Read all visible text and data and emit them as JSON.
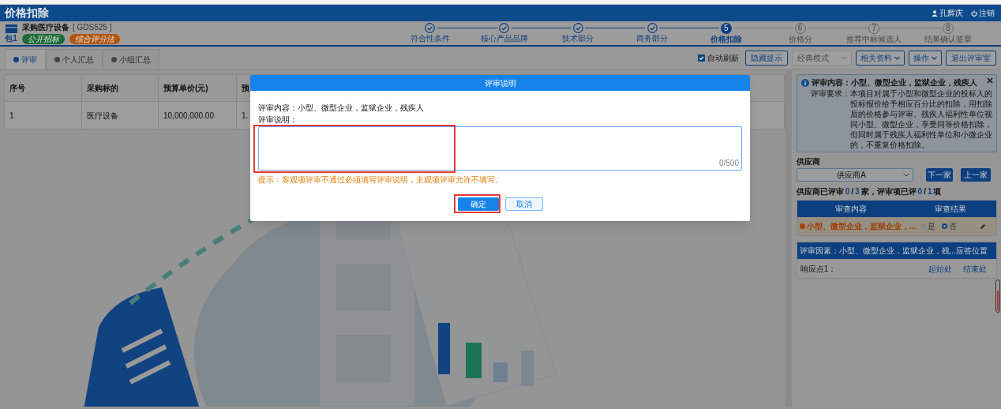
{
  "header": {
    "title": "价格扣除",
    "user": "孔辉庆",
    "logout": "注销"
  },
  "project": {
    "name": "采购医疗设备",
    "code": "[ GDS525 ]",
    "package": "包1",
    "tags": [
      {
        "label": "公开招标",
        "color": "#1a6b35"
      },
      {
        "label": "综合评分法",
        "color": "#b0560c"
      }
    ]
  },
  "steps": [
    {
      "label": "符合性条件",
      "completed": true,
      "selected": false
    },
    {
      "label": "核心产品品牌",
      "completed": true,
      "selected": false
    },
    {
      "label": "技术部分",
      "completed": true,
      "selected": false
    },
    {
      "label": "商务部分",
      "completed": true,
      "selected": false
    },
    {
      "label": "价格扣除",
      "completed": false,
      "selected": true,
      "number": "5"
    },
    {
      "label": "价格分",
      "completed": false,
      "selected": false,
      "number": "6"
    },
    {
      "label": "推荐中标候选人",
      "completed": false,
      "selected": false,
      "number": "7"
    },
    {
      "label": "结果确认签章",
      "completed": false,
      "selected": false,
      "number": "8"
    }
  ],
  "tabs": [
    {
      "label": "评审",
      "selected": true
    },
    {
      "label": "个人汇总",
      "selected": false
    },
    {
      "label": "小组汇总",
      "selected": false
    }
  ],
  "toolbar": {
    "auto_refresh": {
      "label": "自动刷新",
      "checked": true
    },
    "hide_tips": "隐藏提示",
    "mode_select": "经典模式",
    "materials": "相关资料",
    "actions": "操作",
    "exit": "退出评审室"
  },
  "table": {
    "columns": [
      "序号",
      "采购标的",
      "预算单价(元)",
      "预"
    ],
    "rows": [
      [
        "1",
        "医疗设备",
        "10,000,000.00",
        "1."
      ]
    ]
  },
  "info": {
    "title": "评审内容：小型、微型企业，监狱企业，残疾人",
    "requirement_label": "评审要求：",
    "requirement": "本项目对属于小型和微型企业的投标人的投标报价给予相应百分比的扣除，用扣除后的价格参与评审。残疾人福利性单位视同小型、微型企业，享受同等价格扣除，但同时属于残疾人福利性单位和小微企业的，不重复价格扣除。"
  },
  "supplier": {
    "label": "供应商",
    "selected": "供应商A",
    "next": "下一家",
    "prev": "上一家"
  },
  "progress": [
    {
      "kind": "text",
      "text": "供应商已评审"
    },
    {
      "kind": "count",
      "text": "0"
    },
    {
      "kind": "text",
      "text": "/"
    },
    {
      "kind": "count",
      "text": "3"
    },
    {
      "kind": "text",
      "text": "家，评审项已评"
    },
    {
      "kind": "count",
      "text": "0"
    },
    {
      "kind": "text",
      "text": "/"
    },
    {
      "kind": "count",
      "text": "1"
    },
    {
      "kind": "text",
      "text": "项"
    }
  ],
  "review_table": {
    "columns": [
      "审查内容",
      "审查结果"
    ],
    "rows": [
      {
        "content": "小型、微型企业，监狱企业，...",
        "options": [
          {
            "label": "是",
            "selected": false
          },
          {
            "label": "否",
            "selected": true
          }
        ]
      }
    ]
  },
  "response_table": {
    "columns": [
      "评审因素：小型、微型企业，监狱企业，残...",
      "应答位置"
    ],
    "rows": [
      {
        "label": "响应点1：",
        "start": "起始处",
        "end": "结束处"
      }
    ]
  },
  "dialog": {
    "title": "评审说明",
    "content": "评审内容：小型、微型企业，监狱企业，残疾人",
    "field_label": "评审说明：",
    "counter": "0/500",
    "hint": "提示：客观项评审不通过必须填写评审说明，主观项评审允许不填写。",
    "confirm": "确定",
    "cancel": "取消"
  }
}
